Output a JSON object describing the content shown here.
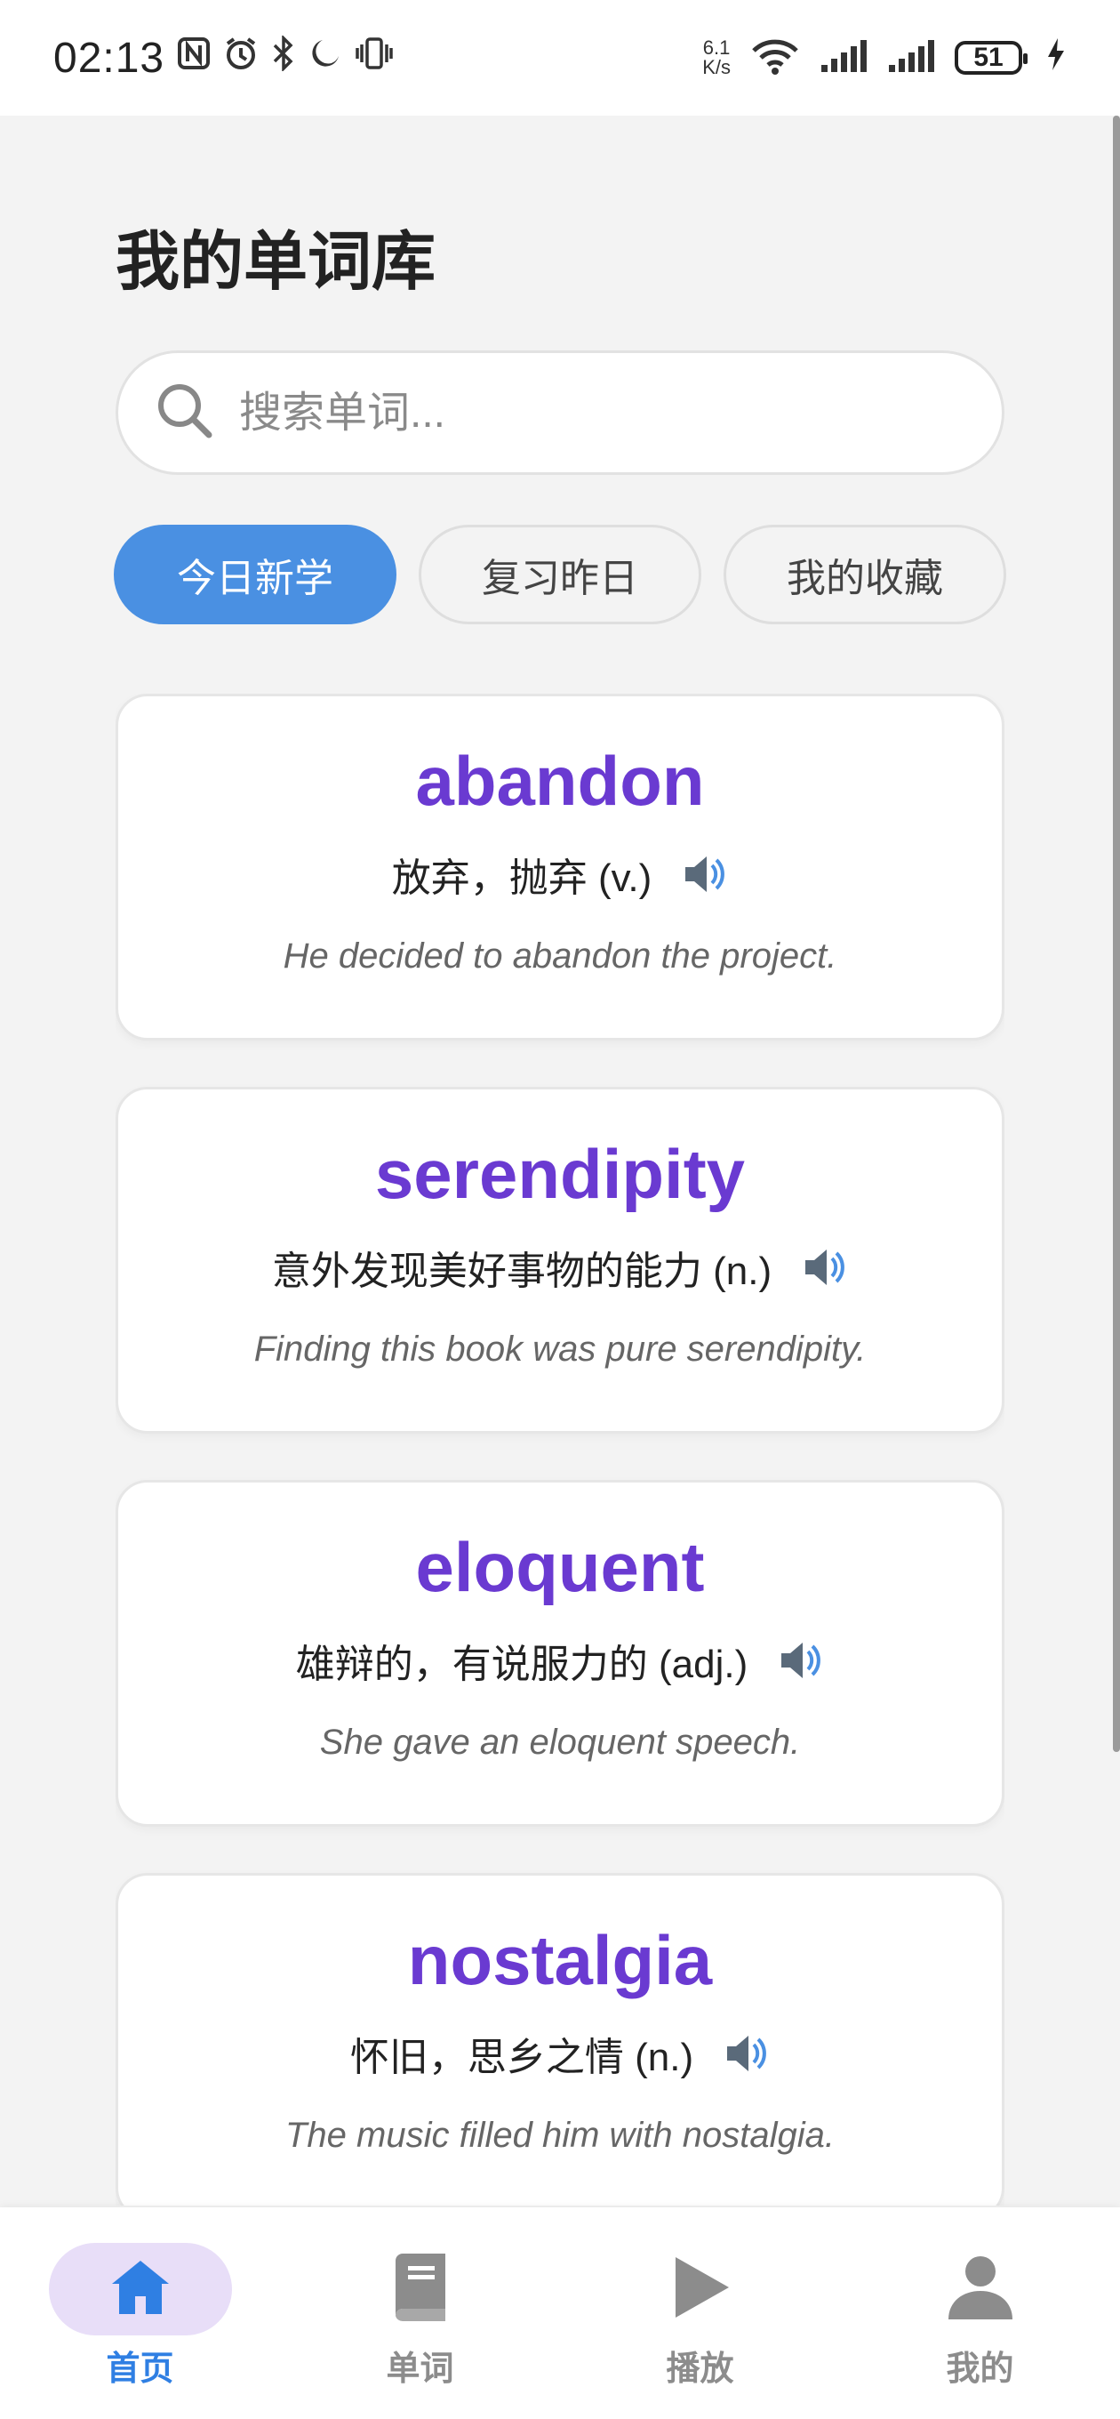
{
  "status_bar": {
    "time": "02:13",
    "net_speed_value": "6.1",
    "net_speed_unit": "K/s",
    "battery_level": "51"
  },
  "page": {
    "title": "我的单词库"
  },
  "search": {
    "placeholder": "搜索单词..."
  },
  "tabs": [
    {
      "label": "今日新学",
      "active": true
    },
    {
      "label": "复习昨日",
      "active": false
    },
    {
      "label": "我的收藏",
      "active": false
    }
  ],
  "words": [
    {
      "word": "abandon",
      "meaning": "放弃，抛弃 (v.)",
      "example": "He decided to abandon the project."
    },
    {
      "word": "serendipity",
      "meaning": "意外发现美好事物的能力 (n.)",
      "example": "Finding this book was pure serendipity."
    },
    {
      "word": "eloquent",
      "meaning": "雄辩的，有说服力的 (adj.)",
      "example": "She gave an eloquent speech."
    },
    {
      "word": "nostalgia",
      "meaning": "怀旧，思乡之情 (n.)",
      "example": "The music filled him with nostalgia."
    }
  ],
  "bottom_nav": [
    {
      "label": "首页",
      "icon": "home-icon",
      "active": true
    },
    {
      "label": "单词",
      "icon": "book-icon",
      "active": false
    },
    {
      "label": "播放",
      "icon": "play-icon",
      "active": false
    },
    {
      "label": "我的",
      "icon": "person-icon",
      "active": false
    }
  ],
  "colors": {
    "accent": "#4a90e2",
    "word": "#6a3ad1",
    "nav_active": "#2f7fe3",
    "nav_active_bg": "#e8def8"
  }
}
